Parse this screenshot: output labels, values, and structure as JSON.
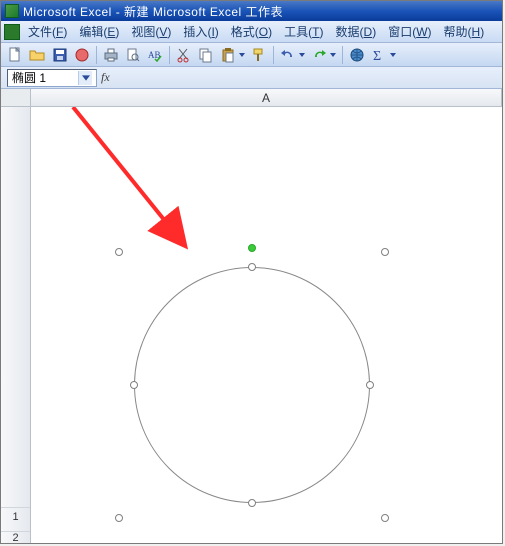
{
  "titlebar": {
    "app_name": "Microsoft Excel",
    "separator": " - ",
    "doc_name": "新建 Microsoft Excel 工作表"
  },
  "menubar": {
    "file": {
      "label": "文件",
      "hotkey": "F"
    },
    "edit": {
      "label": "编辑",
      "hotkey": "E"
    },
    "view": {
      "label": "视图",
      "hotkey": "V"
    },
    "insert": {
      "label": "插入",
      "hotkey": "I"
    },
    "format": {
      "label": "格式",
      "hotkey": "O"
    },
    "tools": {
      "label": "工具",
      "hotkey": "T"
    },
    "data": {
      "label": "数据",
      "hotkey": "D"
    },
    "window": {
      "label": "窗口",
      "hotkey": "W"
    },
    "help": {
      "label": "帮助",
      "hotkey": "H"
    }
  },
  "toolbar_icons": {
    "new": "new-doc-icon",
    "open": "open-folder-icon",
    "save": "save-disk-icon",
    "permission": "permission-icon",
    "print": "print-icon",
    "printpreview": "print-preview-icon",
    "spell": "spellcheck-icon",
    "cut": "cut-icon",
    "copy": "copy-icon",
    "paste": "paste-icon",
    "fmtpainter": "format-painter-icon",
    "undo": "undo-icon",
    "redo": "redo-icon",
    "hyperlink": "hyperlink-icon",
    "autosum": "autosum-icon"
  },
  "namebox": {
    "value": "椭圆 1",
    "fx_label": "fx"
  },
  "columns": {
    "A": "A"
  },
  "rows": {
    "r1": "1",
    "r2": "2"
  },
  "shape": {
    "name": "椭圆 1",
    "type": "oval"
  },
  "annotation": {
    "color": "#ff2b2b"
  }
}
